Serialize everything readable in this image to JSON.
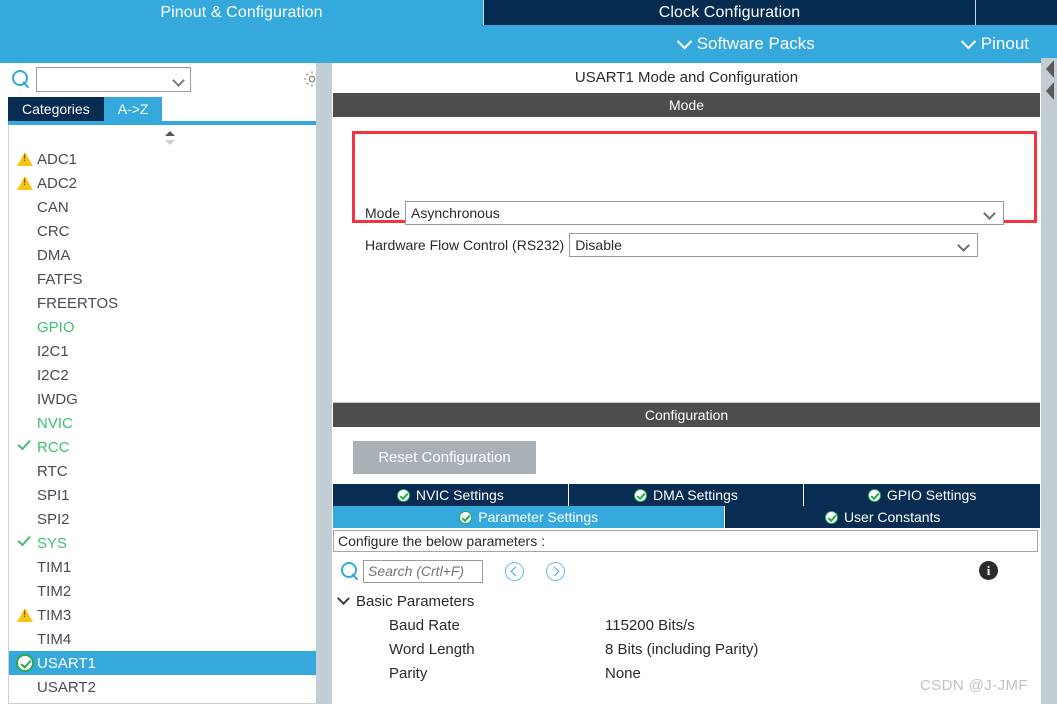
{
  "top_tabs": [
    {
      "label": "Pinout & Configuration",
      "active": true
    },
    {
      "label": "Clock Configuration",
      "active": false
    },
    {
      "label": "",
      "active": false
    }
  ],
  "subbar": {
    "software_packs": "Software Packs",
    "pinout_menu": "Pinout"
  },
  "sidebar": {
    "search": {
      "value": "",
      "placeholder": ""
    },
    "gear_icon": "gear-icon",
    "tabs": [
      {
        "label": "Categories",
        "active": false
      },
      {
        "label": "A->Z",
        "active": true
      }
    ],
    "peripherals": [
      {
        "label": "ADC1",
        "status": "warning",
        "selected": false
      },
      {
        "label": "ADC2",
        "status": "warning",
        "selected": false
      },
      {
        "label": "CAN",
        "status": "none",
        "selected": false
      },
      {
        "label": "CRC",
        "status": "none",
        "selected": false
      },
      {
        "label": "DMA",
        "status": "none",
        "selected": false
      },
      {
        "label": "FATFS",
        "status": "none",
        "selected": false
      },
      {
        "label": "FREERTOS",
        "status": "none",
        "selected": false
      },
      {
        "label": "GPIO",
        "status": "green",
        "selected": false
      },
      {
        "label": "I2C1",
        "status": "none",
        "selected": false
      },
      {
        "label": "I2C2",
        "status": "none",
        "selected": false
      },
      {
        "label": "IWDG",
        "status": "none",
        "selected": false
      },
      {
        "label": "NVIC",
        "status": "green",
        "selected": false
      },
      {
        "label": "RCC",
        "status": "check",
        "selected": false
      },
      {
        "label": "RTC",
        "status": "none",
        "selected": false
      },
      {
        "label": "SPI1",
        "status": "none",
        "selected": false
      },
      {
        "label": "SPI2",
        "status": "none",
        "selected": false
      },
      {
        "label": "SYS",
        "status": "check",
        "selected": false
      },
      {
        "label": "TIM1",
        "status": "none",
        "selected": false
      },
      {
        "label": "TIM2",
        "status": "none",
        "selected": false
      },
      {
        "label": "TIM3",
        "status": "warning",
        "selected": false
      },
      {
        "label": "TIM4",
        "status": "none",
        "selected": false
      },
      {
        "label": "USART1",
        "status": "checkcircle",
        "selected": true
      },
      {
        "label": "USART2",
        "status": "none",
        "selected": false
      }
    ]
  },
  "pane": {
    "title": "USART1 Mode and Configuration",
    "mode_header": "Mode",
    "config_header": "Configuration"
  },
  "mode": {
    "rows": [
      {
        "label": "Mode",
        "value": "Asynchronous"
      },
      {
        "label": "Hardware Flow Control (RS232)",
        "value": "Disable"
      }
    ]
  },
  "configuration": {
    "reset_label": "Reset Configuration",
    "tabs_row1": [
      {
        "label": "NVIC Settings",
        "active": false
      },
      {
        "label": "DMA Settings",
        "active": false
      },
      {
        "label": "GPIO Settings",
        "active": false
      }
    ],
    "tabs_row2": [
      {
        "label": "Parameter Settings",
        "active": true
      },
      {
        "label": "User Constants",
        "active": false
      }
    ],
    "configure_text": "Configure the below parameters :",
    "search_placeholder": "Search (Crtl+F)",
    "info_glyph": "i",
    "groups": [
      {
        "name": "Basic Parameters",
        "params": [
          {
            "name": "Baud Rate",
            "value": "115200 Bits/s"
          },
          {
            "name": "Word Length",
            "value": "8 Bits (including Parity)"
          },
          {
            "name": "Parity",
            "value": "None"
          }
        ]
      }
    ]
  },
  "watermark": "CSDN @J-JMF",
  "colors": {
    "accent_blue": "#35a8dc",
    "dark_navy": "#082c52",
    "header_gray": "#4d4d4d",
    "highlight_red": "#f5333f",
    "green": "#3fbf6f",
    "warning_yellow": "#f5c518"
  }
}
